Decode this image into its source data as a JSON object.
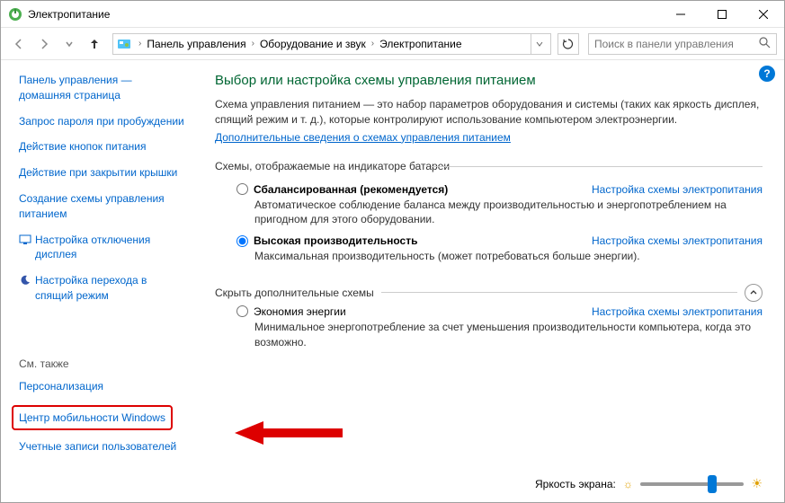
{
  "window": {
    "title": "Электропитание"
  },
  "breadcrumb": {
    "items": [
      "Панель управления",
      "Оборудование и звук",
      "Электропитание"
    ]
  },
  "search": {
    "placeholder": "Поиск в панели управления"
  },
  "sidebar": {
    "home": "Панель управления — домашняя страница",
    "links": [
      "Запрос пароля при пробуждении",
      "Действие кнопок питания",
      "Действие при закрытии крышки",
      "Создание схемы управления питанием"
    ],
    "display_off": "Настройка отключения дисплея",
    "sleep": "Настройка перехода в спящий режим",
    "see_also_title": "См. также",
    "see_also": {
      "personalization": "Персонализация",
      "mobility": "Центр мобильности Windows",
      "accounts": "Учетные записи пользователей"
    }
  },
  "main": {
    "heading": "Выбор или настройка схемы управления питанием",
    "intro": "Схема управления питанием — это набор параметров оборудования и системы (таких как яркость дисплея, спящий режим и т. д.), которые контролируют использование компьютером электроэнергии.",
    "intro_link": "Дополнительные сведения о схемах управления питанием",
    "indicator_label": "Схемы, отображаемые на индикаторе батареи",
    "plans": {
      "settings_link": "Настройка схемы электропитания",
      "balanced": {
        "label": "Сбалансированная (рекомендуется)",
        "desc": "Автоматическое соблюдение баланса между производительностью и энергопотреблением на пригодном для этого оборудовании."
      },
      "high": {
        "label": "Высокая производительность",
        "desc": "Максимальная производительность (может потребоваться больше энергии)."
      },
      "eco": {
        "label": "Экономия энергии",
        "desc": "Минимальное энергопотребление за счет уменьшения производительности компьютера, когда это возможно."
      }
    },
    "hide_extra": "Скрыть дополнительные схемы",
    "brightness_label": "Яркость экрана:"
  }
}
